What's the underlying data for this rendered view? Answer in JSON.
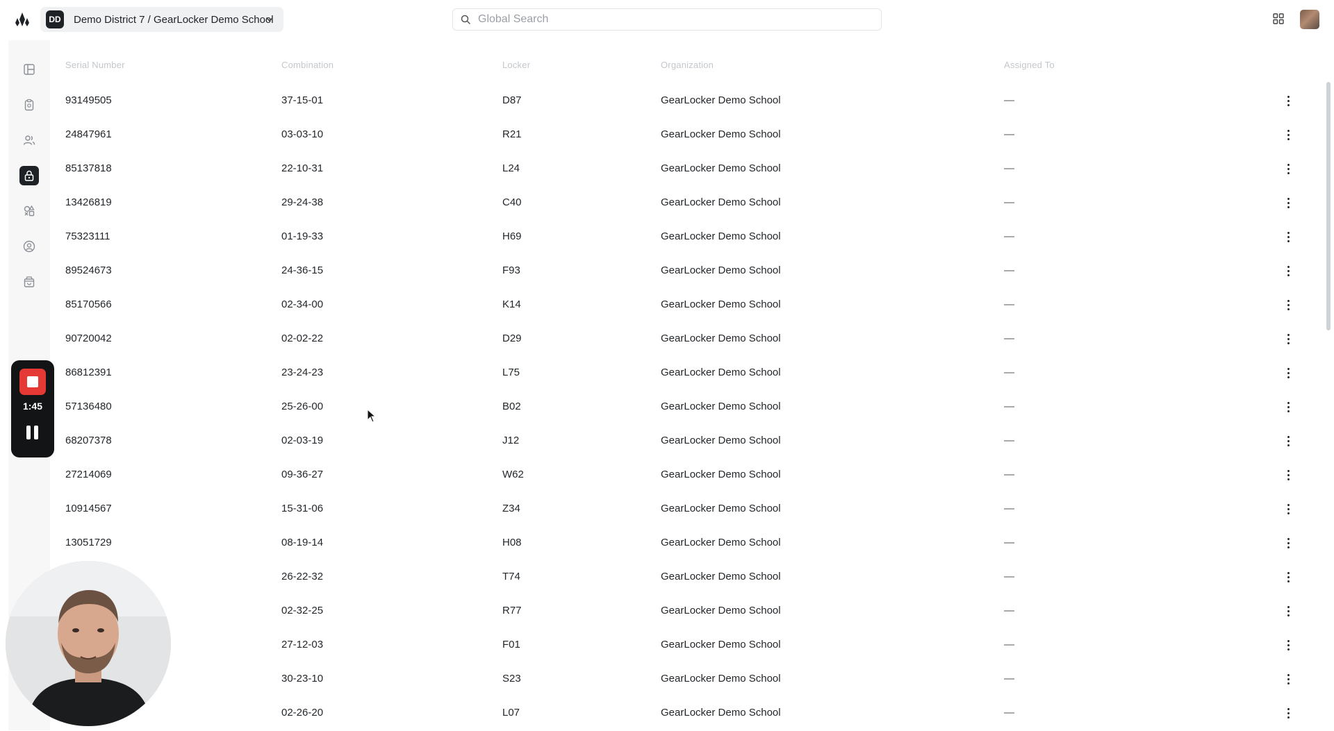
{
  "header": {
    "workspace_badge": "DD",
    "workspace_name": "Demo District 7 / GearLocker Demo School",
    "search_placeholder": "Global Search"
  },
  "sidebar": {
    "items": [
      {
        "name": "dashboard",
        "icon": "layout-icon",
        "active": false
      },
      {
        "name": "inventory",
        "icon": "clipboard-icon",
        "active": false
      },
      {
        "name": "users",
        "icon": "users-icon",
        "active": false
      },
      {
        "name": "lockers",
        "icon": "lock-icon",
        "active": true
      },
      {
        "name": "equipment",
        "icon": "shapes-icon",
        "active": false
      },
      {
        "name": "profile",
        "icon": "user-circle-icon",
        "active": false
      },
      {
        "name": "store",
        "icon": "shopping-bag-icon",
        "active": false
      }
    ]
  },
  "recorder": {
    "time": "1:45"
  },
  "table": {
    "columns": [
      "Serial Number",
      "Combination",
      "Locker",
      "Organization",
      "Assigned To"
    ],
    "rows": [
      {
        "serial": "93149505",
        "combination": "37-15-01",
        "locker": "D87",
        "organization": "GearLocker Demo School",
        "assigned": "—"
      },
      {
        "serial": "24847961",
        "combination": "03-03-10",
        "locker": "R21",
        "organization": "GearLocker Demo School",
        "assigned": "—"
      },
      {
        "serial": "85137818",
        "combination": "22-10-31",
        "locker": "L24",
        "organization": "GearLocker Demo School",
        "assigned": "—"
      },
      {
        "serial": "13426819",
        "combination": "29-24-38",
        "locker": "C40",
        "organization": "GearLocker Demo School",
        "assigned": "—"
      },
      {
        "serial": "75323111",
        "combination": "01-19-33",
        "locker": "H69",
        "organization": "GearLocker Demo School",
        "assigned": "—"
      },
      {
        "serial": "89524673",
        "combination": "24-36-15",
        "locker": "F93",
        "organization": "GearLocker Demo School",
        "assigned": "—"
      },
      {
        "serial": "85170566",
        "combination": "02-34-00",
        "locker": "K14",
        "organization": "GearLocker Demo School",
        "assigned": "—"
      },
      {
        "serial": "90720042",
        "combination": "02-02-22",
        "locker": "D29",
        "organization": "GearLocker Demo School",
        "assigned": "—"
      },
      {
        "serial": "86812391",
        "combination": "23-24-23",
        "locker": "L75",
        "organization": "GearLocker Demo School",
        "assigned": "—"
      },
      {
        "serial": "57136480",
        "combination": "25-26-00",
        "locker": "B02",
        "organization": "GearLocker Demo School",
        "assigned": "—"
      },
      {
        "serial": "68207378",
        "combination": "02-03-19",
        "locker": "J12",
        "organization": "GearLocker Demo School",
        "assigned": "—"
      },
      {
        "serial": "27214069",
        "combination": "09-36-27",
        "locker": "W62",
        "organization": "GearLocker Demo School",
        "assigned": "—"
      },
      {
        "serial": "10914567",
        "combination": "15-31-06",
        "locker": "Z34",
        "organization": "GearLocker Demo School",
        "assigned": "—"
      },
      {
        "serial": "13051729",
        "combination": "08-19-14",
        "locker": "H08",
        "organization": "GearLocker Demo School",
        "assigned": "—"
      },
      {
        "serial": "",
        "combination": "26-22-32",
        "locker": "T74",
        "organization": "GearLocker Demo School",
        "assigned": "—"
      },
      {
        "serial": "",
        "combination": "02-32-25",
        "locker": "R77",
        "organization": "GearLocker Demo School",
        "assigned": "—"
      },
      {
        "serial": "",
        "combination": "27-12-03",
        "locker": "F01",
        "organization": "GearLocker Demo School",
        "assigned": "—"
      },
      {
        "serial": "",
        "combination": "30-23-10",
        "locker": "S23",
        "organization": "GearLocker Demo School",
        "assigned": "—"
      },
      {
        "serial": "",
        "combination": "02-26-20",
        "locker": "L07",
        "organization": "GearLocker Demo School",
        "assigned": "—"
      }
    ]
  }
}
